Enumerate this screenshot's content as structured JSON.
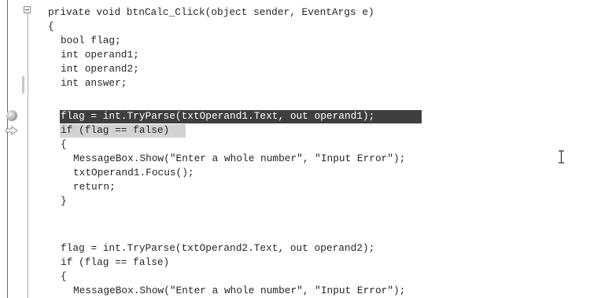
{
  "editor": {
    "lines": {
      "l1": "private void btnCalc_Click(object sender, EventArgs e)",
      "l2": "{",
      "l3": "bool flag;",
      "l4": "int operand1;",
      "l5": "int operand2;",
      "l6": "int answer;",
      "l7": "flag = int.TryParse(txtOperand1.Text, out operand1);",
      "l8": "if (flag == false)",
      "l9": "{",
      "l10": "MessageBox.Show(\"Enter a whole number\", \"Input Error\");",
      "l11": "txtOperand1.Focus();",
      "l12": "return;",
      "l13": "}",
      "l14": "flag = int.TryParse(txtOperand2.Text, out operand2);",
      "l15": "if (flag == false)",
      "l16": "{",
      "l17": "MessageBox.Show(\"Enter a whole number\", \"Input Error\");"
    },
    "margin_icons": {
      "collapse": "collapse-minus-icon",
      "breakpoint": "breakpoint-icon",
      "current_statement": "current-statement-arrow-icon",
      "cursor": "ibeam-cursor-icon"
    },
    "colors": {
      "breakpoint_highlight": "#3f3f3f",
      "current_statement_highlight": "#d2d2d2"
    }
  }
}
